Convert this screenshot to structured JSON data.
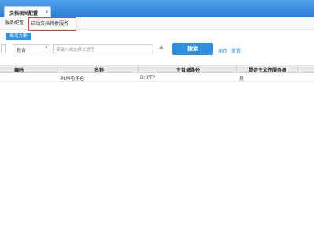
{
  "tab": {
    "title": "文档相关配置",
    "close": "×"
  },
  "subtabs": [
    "服务配置",
    "启动文档转换服务"
  ],
  "toolbar": {
    "add_label": "新增方案"
  },
  "filter": {
    "operator": "包含",
    "operator_arrow": "▾",
    "placeholder": "请输入或选择关键字",
    "expand_glyph": "≚",
    "search_label": "搜索",
    "save_label": "保存",
    "reset_label": "重置"
  },
  "table": {
    "columns": [
      "编码",
      "名称",
      "主目录路径",
      "是否主文件服务器"
    ],
    "rows": [
      {
        "code": "",
        "name": "PLM电子仓",
        "dir": "D:\\FTP",
        "main": "是"
      }
    ]
  }
}
